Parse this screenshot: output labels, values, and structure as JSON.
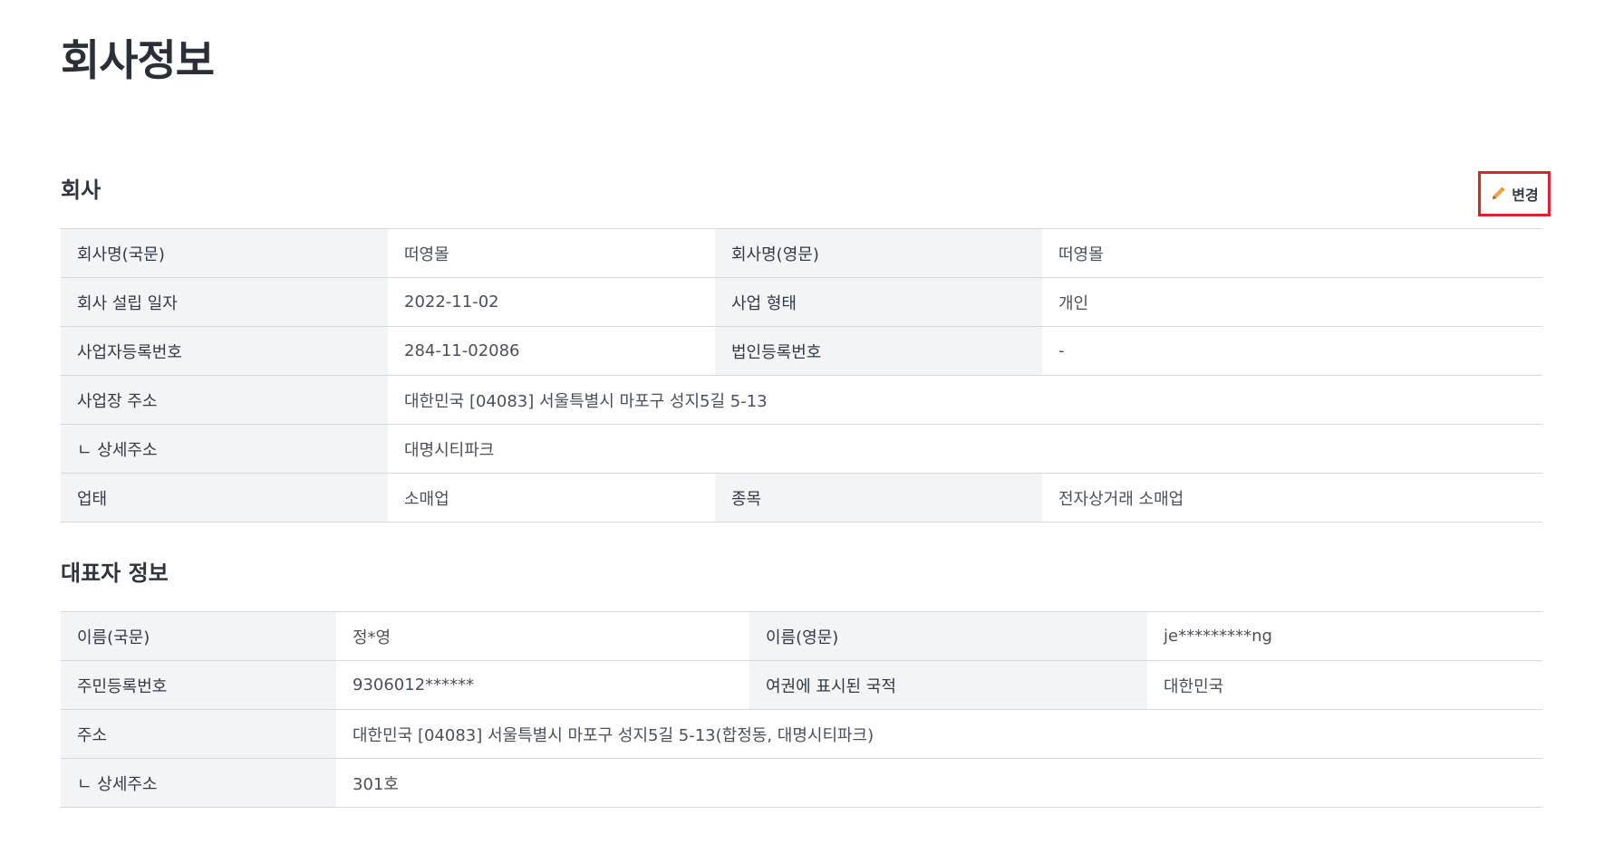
{
  "page": {
    "title": "회사정보"
  },
  "company": {
    "title": "회사",
    "edit_label": "변경",
    "rows": {
      "name_kr": {
        "label": "회사명(국문)",
        "value": "떠영몰"
      },
      "name_en": {
        "label": "회사명(영문)",
        "value": "떠영몰"
      },
      "founded": {
        "label": "회사 설립 일자",
        "value": "2022-11-02"
      },
      "biz_type": {
        "label": "사업 형태",
        "value": "개인"
      },
      "biz_reg_no": {
        "label": "사업자등록번호",
        "value": "284-11-02086"
      },
      "corp_reg_no": {
        "label": "법인등록번호",
        "value": "-"
      },
      "address": {
        "label": "사업장 주소",
        "value": "대한민국 [04083] 서울특별시 마포구 성지5길 5-13"
      },
      "address_detail": {
        "label": "ㄴ 상세주소",
        "value": "대명시티파크"
      },
      "industry": {
        "label": "업태",
        "value": "소매업"
      },
      "item": {
        "label": "종목",
        "value": "전자상거래 소매업"
      }
    }
  },
  "representative": {
    "title": "대표자 정보",
    "rows": {
      "name_kr": {
        "label": "이름(국문)",
        "value": "정*영"
      },
      "name_en": {
        "label": "이름(영문)",
        "value": "je*********ng"
      },
      "resident_no": {
        "label": "주민등록번호",
        "value": "9306012******"
      },
      "nationality": {
        "label": "여권에 표시된 국적",
        "value": "대한민국"
      },
      "address": {
        "label": "주소",
        "value": "대한민국 [04083] 서울특별시 마포구 성지5길 5-13(합정동, 대명시티파크)"
      },
      "address_detail": {
        "label": "ㄴ 상세주소",
        "value": "301호"
      }
    }
  },
  "colors": {
    "header_cell_bg": "#f3f4f6",
    "border": "#d4d7dc",
    "highlight": "#e0222a",
    "pencil": "#f2a33a"
  }
}
